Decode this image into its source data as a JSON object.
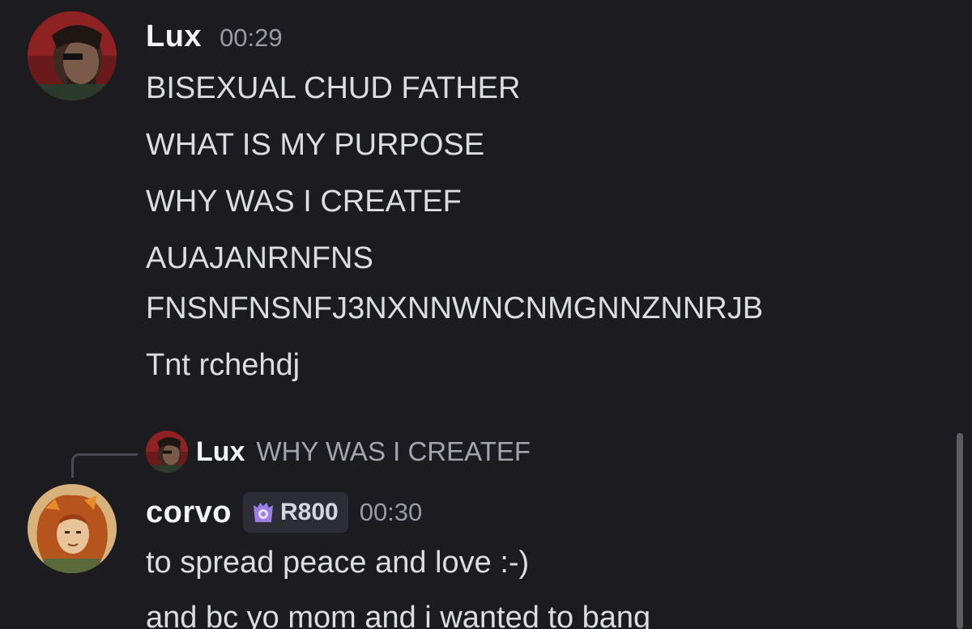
{
  "messages": [
    {
      "author": "Lux",
      "time": "00:29",
      "lines": [
        "BISEXUAL CHUD FATHER",
        "WHAT IS MY PURPOSE",
        "WHY WAS I CREATEF",
        "AUAJANRNFNS",
        "FNSNFNSNFJ3NXNNWNCNMGNNZNNRJB",
        "Tnt rchehdj"
      ]
    },
    {
      "reply_to": {
        "author": "Lux",
        "text": "WHY WAS I CREATEF"
      },
      "author": "corvo",
      "badge": "R800",
      "time": "00:30",
      "lines": [
        "to spread peace and love :-)",
        "and bc yo mom and i wanted to bang"
      ]
    }
  ],
  "colors": {
    "background": "#1b1b20",
    "username": "#f3f4f6",
    "timestamp": "#9a9ba3",
    "badge_background": "#2c2d35",
    "badge_icon": "#9b7ee6"
  },
  "icons": {
    "badge": "guild-tag-icon"
  }
}
